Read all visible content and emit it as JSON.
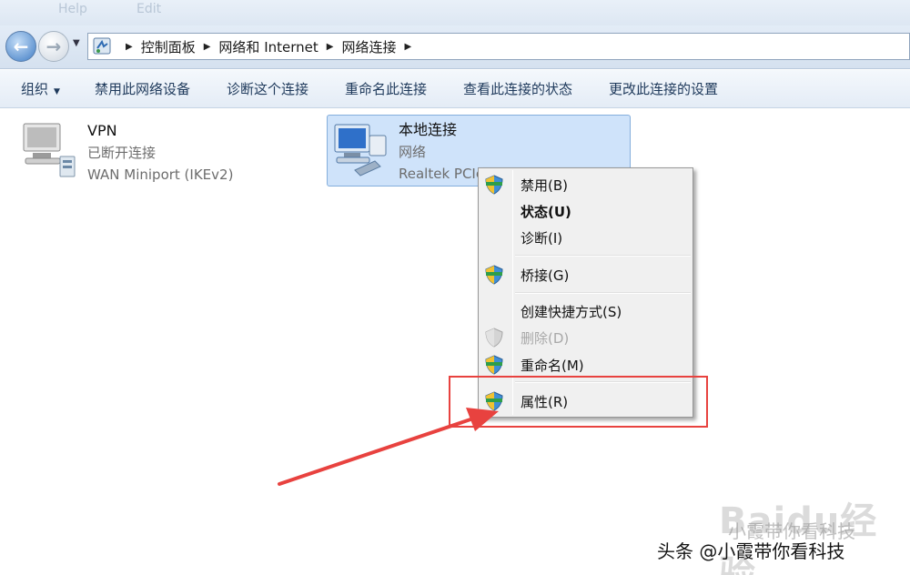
{
  "window": {
    "top_ghost_left": "Help",
    "top_ghost_right": "Edit"
  },
  "navigation": {
    "back_icon": "arrow-left-icon",
    "forward_icon": "arrow-right-icon",
    "breadcrumb": [
      "控制面板",
      "网络和 Internet",
      "网络连接"
    ]
  },
  "toolbar": {
    "organize": "组织",
    "items": [
      "禁用此网络设备",
      "诊断这个连接",
      "重命名此连接",
      "查看此连接的状态",
      "更改此连接的设置"
    ]
  },
  "connections": [
    {
      "name": "VPN",
      "status": "已断开连接",
      "device": "WAN Miniport (IKEv2)",
      "icon": "vpn-connection-icon"
    },
    {
      "name": "本地连接",
      "status": "网络",
      "device": "Realtek PCIe GBE Family Controller",
      "icon": "ethernet-connection-icon"
    }
  ],
  "context_menu": {
    "items": [
      {
        "label": "禁用(B)",
        "icon": "shield-icon",
        "bold": false,
        "disabled": false
      },
      {
        "label": "状态(U)",
        "icon": "",
        "bold": true,
        "disabled": false
      },
      {
        "label": "诊断(I)",
        "icon": "",
        "bold": false,
        "disabled": false
      },
      {
        "label": "桥接(G)",
        "icon": "shield-icon",
        "bold": false,
        "disabled": false
      },
      {
        "label": "创建快捷方式(S)",
        "icon": "",
        "bold": false,
        "disabled": false
      },
      {
        "label": "删除(D)",
        "icon": "shield-icon",
        "bold": false,
        "disabled": true
      },
      {
        "label": "重命名(M)",
        "icon": "shield-icon",
        "bold": false,
        "disabled": false
      },
      {
        "label": "属性(R)",
        "icon": "shield-icon",
        "bold": false,
        "disabled": false
      }
    ]
  },
  "annotation": {
    "highlight_color": "#e8423f",
    "arrow_color": "#e8423f"
  },
  "watermark": {
    "baidu": "Baidu经验",
    "credit_ghost": "小霞带你看科技",
    "credit": "头条 @小霞带你看科技"
  },
  "colors": {
    "selection": "#cfe3fa",
    "toolbar_text": "#1e395b",
    "menu_bg": "#f0f0f0"
  }
}
